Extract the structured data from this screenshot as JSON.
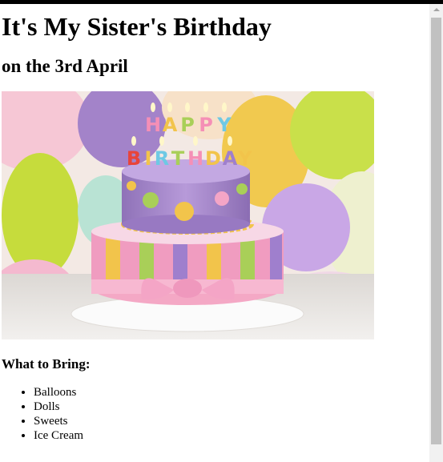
{
  "page": {
    "title": "It's My Sister's Birthday",
    "subtitle": "on the 3rd April",
    "image_icon": "birthday-cake-photo",
    "bring_label": "What to Bring:",
    "bring_items": [
      "Balloons",
      "Dolls",
      "Sweets",
      "Ice Cream"
    ]
  },
  "image_lettering": [
    "HAPPY",
    "BIRTHDAY"
  ],
  "colors": {
    "background": "#ffffff",
    "text": "#000000",
    "top_border": "#000000",
    "scrollbar_track": "#f1f1f1",
    "scrollbar_thumb": "#c1c1c1"
  }
}
